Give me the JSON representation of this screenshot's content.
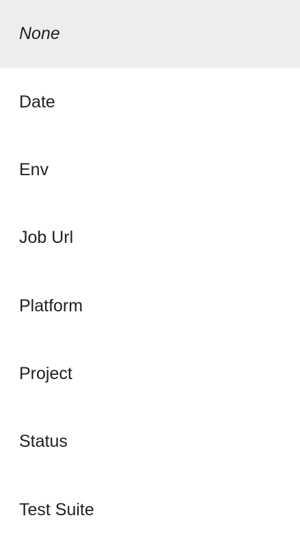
{
  "dropdown": {
    "selected_value": "None",
    "colors": {
      "selected_background": "#ecedef",
      "background": "#ffffff",
      "text": "#212121"
    },
    "options": [
      {
        "label": "None",
        "italic": true,
        "selected": true
      },
      {
        "label": "Date",
        "italic": false,
        "selected": false
      },
      {
        "label": "Env",
        "italic": false,
        "selected": false
      },
      {
        "label": "Job Url",
        "italic": false,
        "selected": false
      },
      {
        "label": "Platform",
        "italic": false,
        "selected": false
      },
      {
        "label": "Project",
        "italic": false,
        "selected": false
      },
      {
        "label": "Status",
        "italic": false,
        "selected": false
      },
      {
        "label": "Test Suite",
        "italic": false,
        "selected": false
      }
    ]
  }
}
